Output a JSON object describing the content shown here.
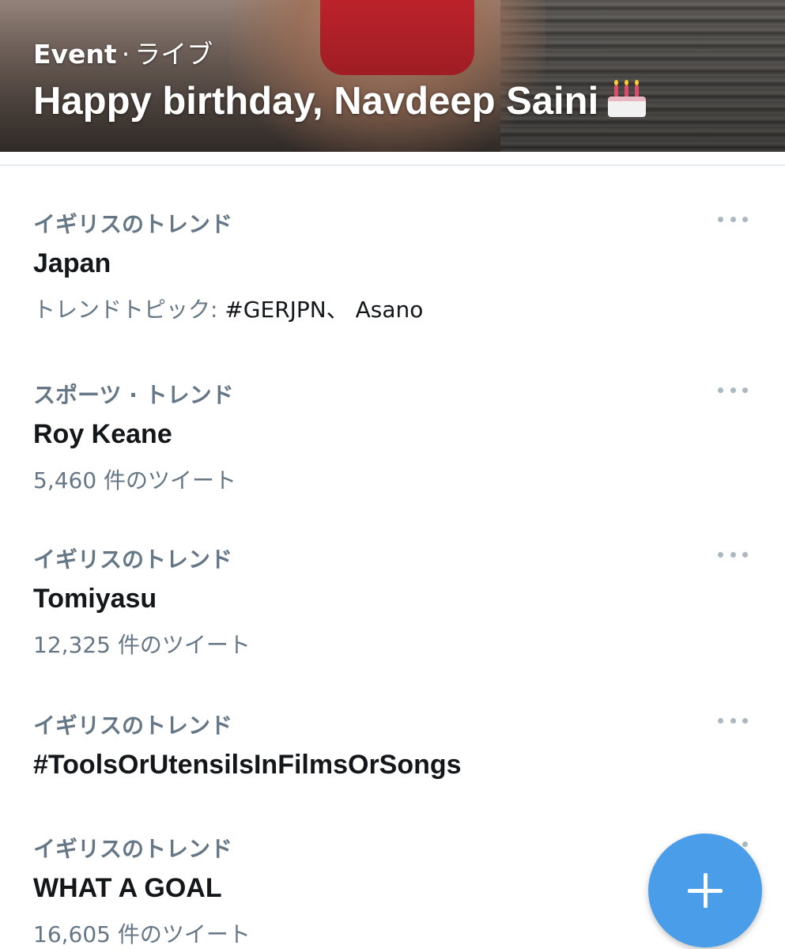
{
  "hero": {
    "category": "Event",
    "separator": "·",
    "status": "ライブ",
    "title": "Happy birthday, Navdeep Saini",
    "title_emoji": "birthday-cake-icon"
  },
  "trends": [
    {
      "context": "イギリスのトレンド",
      "name": "Japan",
      "meta_prefix": "トレンドトピック: ",
      "meta_value": "#GERJPN、 Asano"
    },
    {
      "context": "スポーツ · トレンド",
      "name": "Roy Keane",
      "meta_prefix": "5,460 件のツイート",
      "meta_value": ""
    },
    {
      "context": "イギリスのトレンド",
      "name": "Tomiyasu",
      "meta_prefix": "12,325 件のツイート",
      "meta_value": ""
    },
    {
      "context": "イギリスのトレンド",
      "name": "#ToolsOrUtensilsInFilmsOrSongs",
      "meta_prefix": "",
      "meta_value": ""
    },
    {
      "context": "イギリスのトレンド",
      "name": "WHAT A GOAL",
      "meta_prefix": "16,605 件のツイート",
      "meta_value": ""
    }
  ],
  "icons": {
    "more": "more-icon",
    "compose": "compose-icon"
  },
  "colors": {
    "accent": "#4a9ee9",
    "secondary_text": "#657786",
    "primary_text": "#14171a"
  }
}
